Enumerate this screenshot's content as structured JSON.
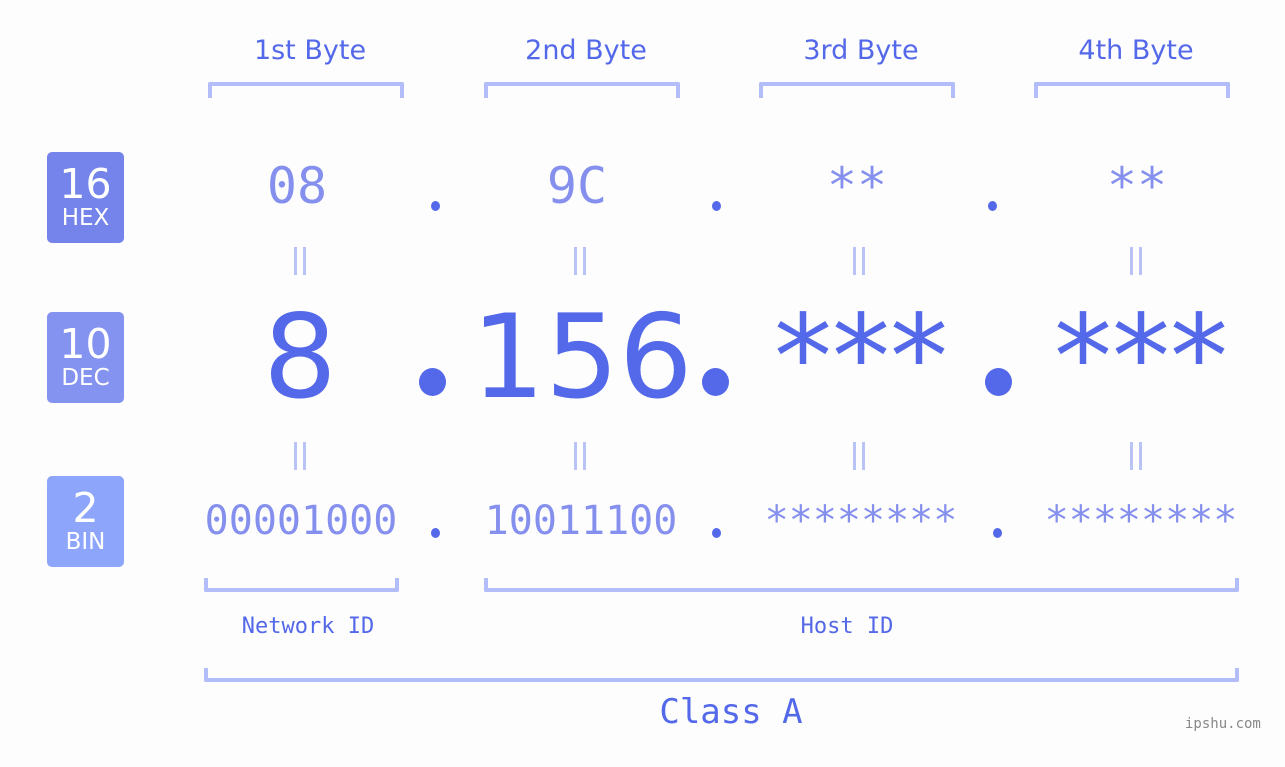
{
  "bytes": [
    {
      "header": "1st Byte",
      "hex": "08",
      "dec": "8",
      "bin": "00001000"
    },
    {
      "header": "2nd Byte",
      "hex": "9C",
      "dec": "156",
      "bin": "10011100"
    },
    {
      "header": "3rd Byte",
      "hex": "**",
      "dec": "***",
      "bin": "********"
    },
    {
      "header": "4th Byte",
      "hex": "**",
      "dec": "***",
      "bin": "********"
    }
  ],
  "badges": {
    "hex": {
      "num": "16",
      "label": "HEX",
      "color": "#7484ea"
    },
    "dec": {
      "num": "10",
      "label": "DEC",
      "color": "#8593f0"
    },
    "bin": {
      "num": "2",
      "label": "BIN",
      "color": "#8da6fb"
    }
  },
  "segments": {
    "network": "Network ID",
    "host": "Host ID"
  },
  "class_label": "Class A",
  "watermark": "ipshu.com",
  "colors": {
    "accent": "#5468ea",
    "muted": "#8590ee",
    "bracket": "#b3bdf9"
  }
}
